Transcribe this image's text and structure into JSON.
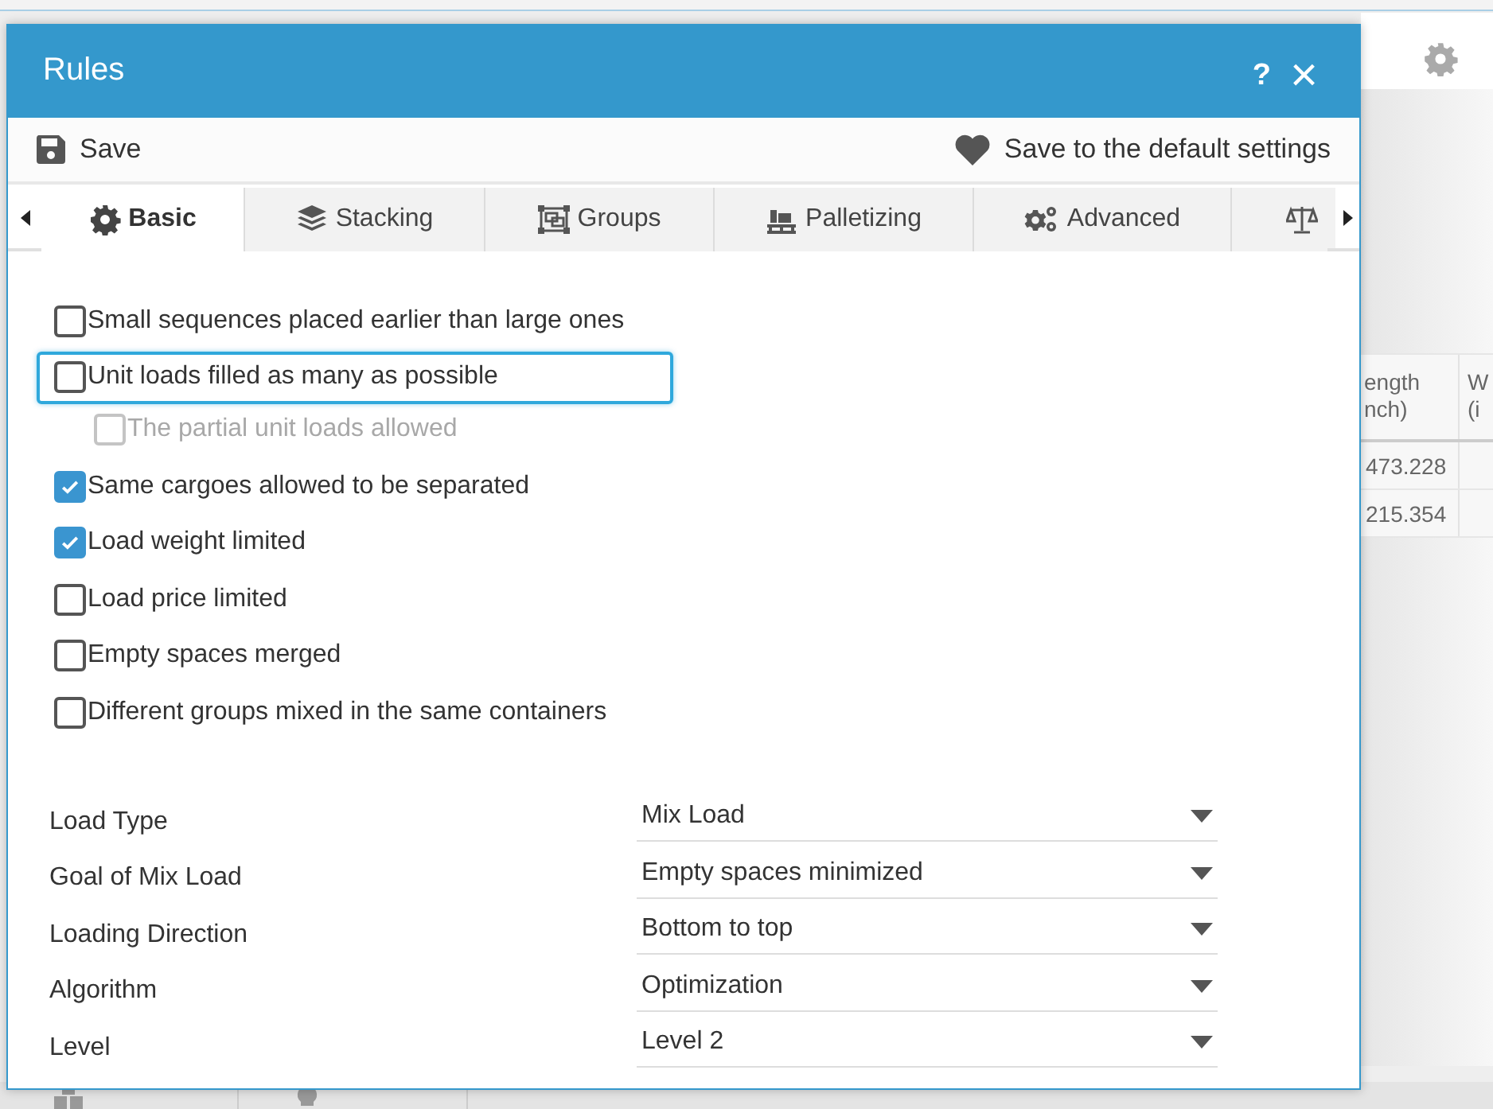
{
  "background": {
    "table": {
      "columns": [
        "ength\nnch)",
        "W\n(i"
      ],
      "rows": [
        [
          "473.228"
        ],
        [
          "215.354"
        ]
      ]
    }
  },
  "window": {
    "title": "Rules",
    "help": "?",
    "close": "×"
  },
  "toolbar": {
    "save": "Save",
    "save_default": "Save to the default settings"
  },
  "tabs": [
    {
      "label": "Basic",
      "selected": true
    },
    {
      "label": "Stacking",
      "selected": false
    },
    {
      "label": "Groups",
      "selected": false
    },
    {
      "label": "Palletizing",
      "selected": false
    },
    {
      "label": "Advanced",
      "selected": false
    },
    {
      "selected": false
    }
  ],
  "options": [
    {
      "label": "Small sequences placed earlier than large ones",
      "checked": false,
      "disabled": false,
      "focused": false
    },
    {
      "label": "Unit loads filled as many as possible",
      "checked": false,
      "disabled": false,
      "focused": true,
      "children": [
        {
          "label": "The partial unit loads allowed",
          "checked": false,
          "disabled": true,
          "focused": false
        }
      ]
    },
    {
      "label": "Same cargoes allowed to be separated",
      "checked": true,
      "disabled": false,
      "focused": false
    },
    {
      "label": "Load weight limited",
      "checked": true,
      "disabled": false,
      "focused": false
    },
    {
      "label": "Load price limited",
      "checked": false,
      "disabled": false,
      "focused": false
    },
    {
      "label": "Empty spaces merged",
      "checked": false,
      "disabled": false,
      "focused": false
    },
    {
      "label": "Different groups mixed in the same containers",
      "checked": false,
      "disabled": false,
      "focused": false
    }
  ],
  "settings": [
    {
      "label": "Load Type",
      "value": "Mix Load"
    },
    {
      "label": "Goal of Mix Load",
      "value": "Empty spaces minimized"
    },
    {
      "label": "Loading Direction",
      "value": "Bottom to top"
    },
    {
      "label": "Algorithm",
      "value": "Optimization"
    },
    {
      "label": "Level",
      "value": "Level 2"
    }
  ]
}
